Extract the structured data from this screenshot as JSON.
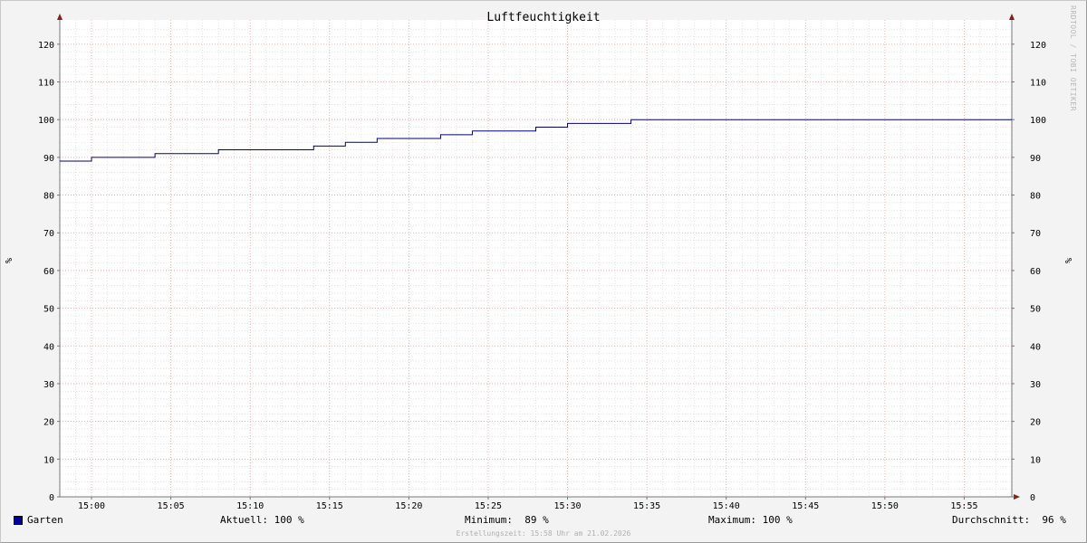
{
  "chart_data": {
    "type": "line",
    "title": "Luftfeuchtigkeit",
    "ylabel": "%",
    "ylim": [
      0,
      125
    ],
    "y_ticks": [
      0,
      10,
      20,
      30,
      40,
      50,
      60,
      70,
      80,
      90,
      100,
      110,
      120
    ],
    "x_ticks": [
      "15:00",
      "15:05",
      "15:10",
      "15:15",
      "15:20",
      "15:25",
      "15:30",
      "15:35",
      "15:40",
      "15:45",
      "15:50",
      "15:55"
    ],
    "xlim": [
      "14:58",
      "15:58"
    ],
    "grid": true,
    "series": [
      {
        "name": "Garten",
        "color": "#000080",
        "step": true,
        "x": [
          "14:58",
          "15:00",
          "15:04",
          "15:08",
          "15:14",
          "15:16",
          "15:18",
          "15:22",
          "15:24",
          "15:28",
          "15:30",
          "15:34",
          "15:58"
        ],
        "values": [
          89,
          90,
          91,
          92,
          93,
          94,
          95,
          96,
          97,
          98,
          99,
          100,
          100
        ]
      }
    ]
  },
  "legend": {
    "series_name": "Garten",
    "swatch_color": "#0000a0",
    "current": "Aktuell: 100 %",
    "minimum": "Minimum:  89 %",
    "maximum": "Maximum: 100 %",
    "average": "Durchschnitt:  96 %"
  },
  "footer": "Erstellungszeit: 15:58 Uhr am 21.02.2026",
  "watermark": "RRDTOOL / TOBI OETIKER"
}
